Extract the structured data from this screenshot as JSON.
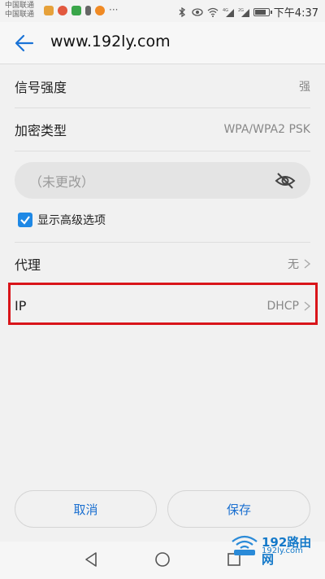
{
  "status_bar": {
    "carrier1": "中国联通",
    "carrier2": "中国联通",
    "time": "下午4:37",
    "signal1": "4G",
    "signal2": "2G"
  },
  "header": {
    "title": "www.192ly.com"
  },
  "rows": {
    "signal_strength": {
      "label": "信号强度",
      "value": "强"
    },
    "encryption": {
      "label": "加密类型",
      "value": "WPA/WPA2 PSK"
    },
    "proxy": {
      "label": "代理",
      "value": "无"
    },
    "ip": {
      "label": "IP",
      "value": "DHCP"
    }
  },
  "password": {
    "placeholder": "（未更改）"
  },
  "advanced": {
    "label": "显示高级选项",
    "checked": true
  },
  "buttons": {
    "cancel": "取消",
    "save": "保存"
  },
  "watermark": {
    "title": "192路由网",
    "url": "192ly.com",
    "prefix": "192"
  },
  "colors": {
    "accent": "#1e88e5",
    "highlight": "#d9151a",
    "button_text": "#1a6fd0"
  }
}
